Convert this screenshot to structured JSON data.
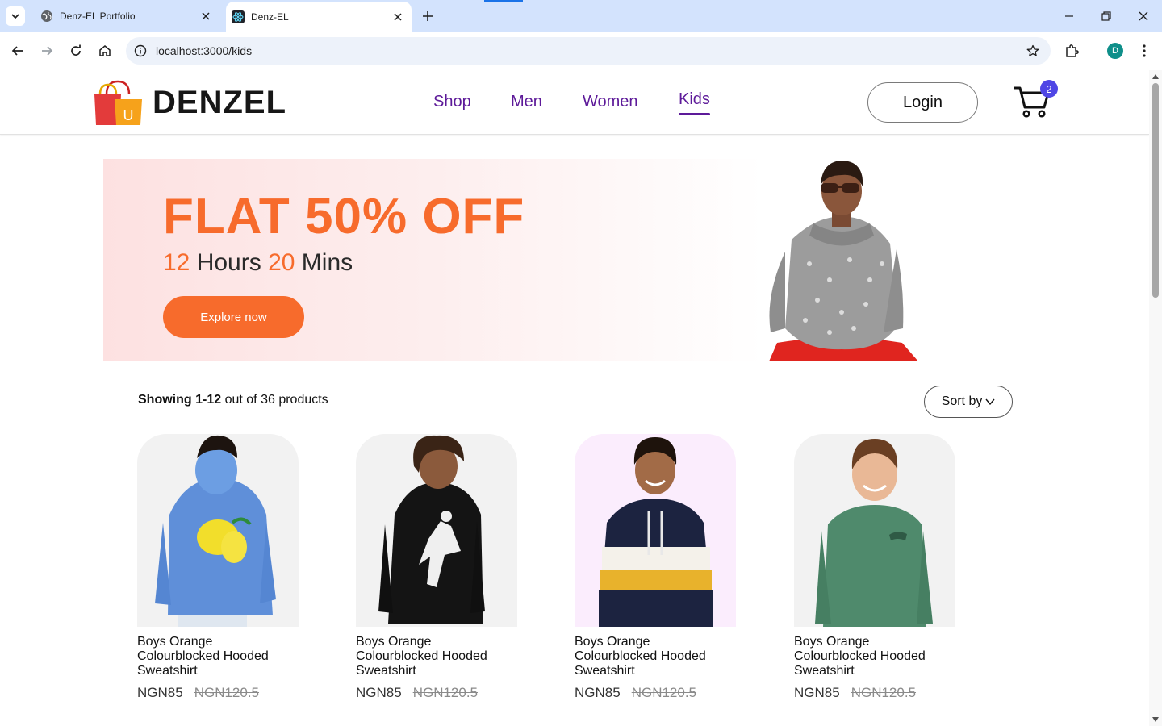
{
  "browser": {
    "tabs": [
      {
        "title": "Denz-EL Portfolio",
        "active": false
      },
      {
        "title": "Denz-EL",
        "active": true
      }
    ],
    "url": "localhost:3000/kids",
    "profile_initial": "D"
  },
  "navbar": {
    "brand": "DENZEL",
    "logo_letter": "U",
    "links": [
      "Shop",
      "Men",
      "Women",
      "Kids"
    ],
    "active_link": "Kids",
    "login_label": "Login",
    "cart_count": "2"
  },
  "hero": {
    "headline": "FLAT 50% OFF",
    "hours_value": "12",
    "hours_label": " Hours ",
    "mins_value": "20",
    "mins_label": " Mins",
    "cta_label": "Explore now"
  },
  "listing": {
    "showing_label": "Showing",
    "showing_range": "1-12",
    "showing_suffix": "out of 36 products",
    "sort_label": "Sort by"
  },
  "products": [
    {
      "name": "Boys Orange Colourblocked Hooded Sweatshirt",
      "new_price": "NGN85",
      "old_price": "NGN120.5"
    },
    {
      "name": "Boys Orange Colourblocked Hooded Sweatshirt",
      "new_price": "NGN85",
      "old_price": "NGN120.5"
    },
    {
      "name": "Boys Orange Colourblocked Hooded Sweatshirt",
      "new_price": "NGN85",
      "old_price": "NGN120.5"
    },
    {
      "name": "Boys Orange Colourblocked Hooded Sweatshirt",
      "new_price": "NGN85",
      "old_price": "NGN120.5"
    }
  ],
  "colors": {
    "accent": "#f76b2c",
    "nav_link": "#5d1a99",
    "badge": "#4f46e5"
  },
  "icons": [
    "tab-list-icon",
    "globe-icon",
    "react-icon",
    "close-icon",
    "plus-icon",
    "minimize-icon",
    "restore-icon",
    "back-icon",
    "forward-icon",
    "reload-icon",
    "home-icon",
    "info-icon",
    "star-icon",
    "extensions-icon",
    "more-icon",
    "shopping-bag-icon",
    "cart-icon",
    "chevron-down-icon"
  ]
}
